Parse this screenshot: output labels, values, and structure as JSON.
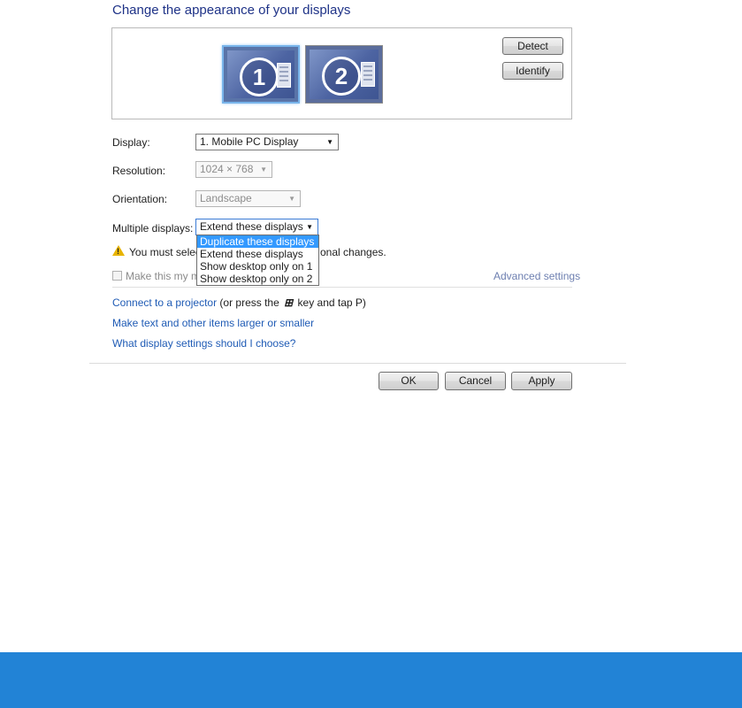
{
  "title": "Change the appearance of your displays",
  "preview": {
    "monitors": [
      {
        "number": "1",
        "selected": true
      },
      {
        "number": "2",
        "selected": false
      }
    ],
    "detect_label": "Detect",
    "identify_label": "Identify"
  },
  "fields": {
    "display": {
      "label": "Display:",
      "value": "1. Mobile PC Display"
    },
    "resolution": {
      "label": "Resolution:",
      "value": "1024 × 768"
    },
    "orientation": {
      "label": "Orientation:",
      "value": "Landscape"
    },
    "multiple": {
      "label": "Multiple displays:",
      "value": "Extend these displays",
      "options": [
        "Duplicate these displays",
        "Extend these displays",
        "Show desktop only on 1",
        "Show desktop only on 2"
      ],
      "highlighted_index": 0
    }
  },
  "warning": {
    "text_start": "You must selec",
    "text_end": "onal changes."
  },
  "main_display_checkbox": {
    "label": "Make this my ma",
    "checked": false
  },
  "advanced_settings_label": "Advanced settings",
  "links": {
    "projector_link": "Connect to a projector",
    "projector_hint_1": "(or press the",
    "projector_key_icon": "windows-logo-icon",
    "projector_hint_2": "key and tap P)",
    "text_size": "Make text and other items larger or smaller",
    "help": "What display settings should I choose?"
  },
  "buttons": {
    "ok": "OK",
    "cancel": "Cancel",
    "apply": "Apply"
  },
  "colors": {
    "title": "#1e3287",
    "link": "#1f5bb5",
    "highlight": "#3399ff",
    "bottom_bar": "#2283d6",
    "warning": "#e8b400"
  }
}
